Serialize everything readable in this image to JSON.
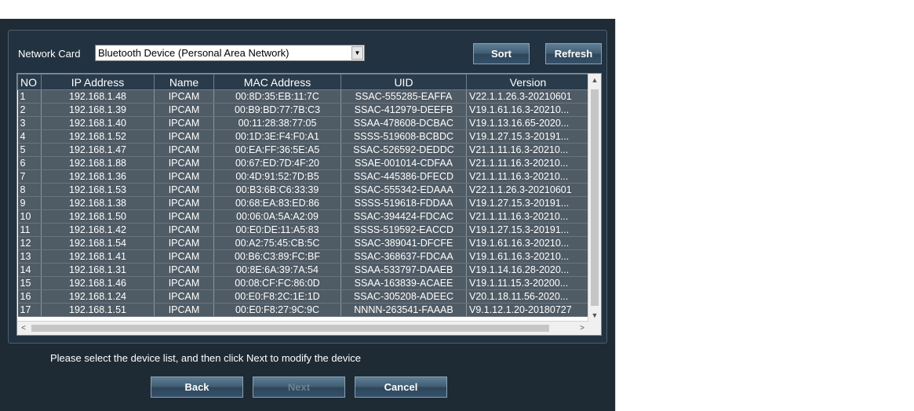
{
  "network_card": {
    "label": "Network Card",
    "selected": "Bluetooth Device (Personal Area Network)"
  },
  "buttons": {
    "sort": "Sort",
    "refresh": "Refresh",
    "back": "Back",
    "next": "Next",
    "cancel": "Cancel"
  },
  "table": {
    "columns": [
      "NO",
      "IP Address",
      "Name",
      "MAC Address",
      "UID",
      "Version"
    ],
    "rows": [
      [
        "1",
        "192.168.1.48",
        "IPCAM",
        "00:8D:35:EB:11:7C",
        "SSAC-555285-EAFFA",
        "V22.1.1.26.3-20210601"
      ],
      [
        "2",
        "192.168.1.39",
        "IPCAM",
        "00:B9:BD:77:7B:C3",
        "SSAC-412979-DEEFB",
        "V19.1.61.16.3-20210..."
      ],
      [
        "3",
        "192.168.1.40",
        "IPCAM",
        "00:11:28:38:77:05",
        "SSAA-478608-DCBAC",
        "V19.1.13.16.65-2020..."
      ],
      [
        "4",
        "192.168.1.52",
        "IPCAM",
        "00:1D:3E:F4:F0:A1",
        "SSSS-519608-BCBDC",
        "V19.1.27.15.3-20191..."
      ],
      [
        "5",
        "192.168.1.47",
        "IPCAM",
        "00:EA:FF:36:5E:A5",
        "SSAC-526592-DEDDC",
        "V21.1.11.16.3-20210..."
      ],
      [
        "6",
        "192.168.1.88",
        "IPCAM",
        "00:67:ED:7D:4F:20",
        "SSAE-001014-CDFAA",
        "V21.1.11.16.3-20210..."
      ],
      [
        "7",
        "192.168.1.36",
        "IPCAM",
        "00:4D:91:52:7D:B5",
        "SSAC-445386-DFECD",
        "V21.1.11.16.3-20210..."
      ],
      [
        "8",
        "192.168.1.53",
        "IPCAM",
        "00:B3:6B:C6:33:39",
        "SSAC-555342-EDAAA",
        "V22.1.1.26.3-20210601"
      ],
      [
        "9",
        "192.168.1.38",
        "IPCAM",
        "00:68:EA:83:ED:86",
        "SSSS-519618-FDDAA",
        "V19.1.27.15.3-20191..."
      ],
      [
        "10",
        "192.168.1.50",
        "IPCAM",
        "00:06:0A:5A:A2:09",
        "SSAC-394424-FDCAC",
        "V21.1.11.16.3-20210..."
      ],
      [
        "11",
        "192.168.1.42",
        "IPCAM",
        "00:E0:DE:11:A5:83",
        "SSSS-519592-EACCD",
        "V19.1.27.15.3-20191..."
      ],
      [
        "12",
        "192.168.1.54",
        "IPCAM",
        "00:A2:75:45:CB:5C",
        "SSAC-389041-DFCFE",
        "V19.1.61.16.3-20210..."
      ],
      [
        "13",
        "192.168.1.41",
        "IPCAM",
        "00:B6:C3:89:FC:BF",
        "SSAC-368637-FDCAA",
        "V19.1.61.16.3-20210..."
      ],
      [
        "14",
        "192.168.1.31",
        "IPCAM",
        "00:8E:6A:39:7A:54",
        "SSAA-533797-DAAEB",
        "V19.1.14.16.28-2020..."
      ],
      [
        "15",
        "192.168.1.46",
        "IPCAM",
        "00:08:CF:FC:86:0D",
        "SSAA-163839-ACAEE",
        "V19.1.11.15.3-20200..."
      ],
      [
        "16",
        "192.168.1.24",
        "IPCAM",
        "00:E0:F8:2C:1E:1D",
        "SSAC-305208-ADEEC",
        "V20.1.18.11.56-2020..."
      ],
      [
        "17",
        "192.168.1.51",
        "IPCAM",
        "00:E0:F8:27:9C:9C",
        "NNNN-263541-FAAAB",
        "V9.1.12.1.20-20180727"
      ]
    ]
  },
  "hint_text": "Please select the device list, and then click Next to modify the device",
  "icons": {
    "dropdown": "chevron-down-icon",
    "scroll_up": "scroll-up-icon",
    "scroll_down": "scroll-down-icon",
    "scroll_left": "scroll-left-icon",
    "scroll_right": "scroll-right-icon"
  },
  "colors": {
    "window_bg": "#1e2b35",
    "row_bg": "#4f5b65",
    "header_bg": "#2a3c4b"
  }
}
